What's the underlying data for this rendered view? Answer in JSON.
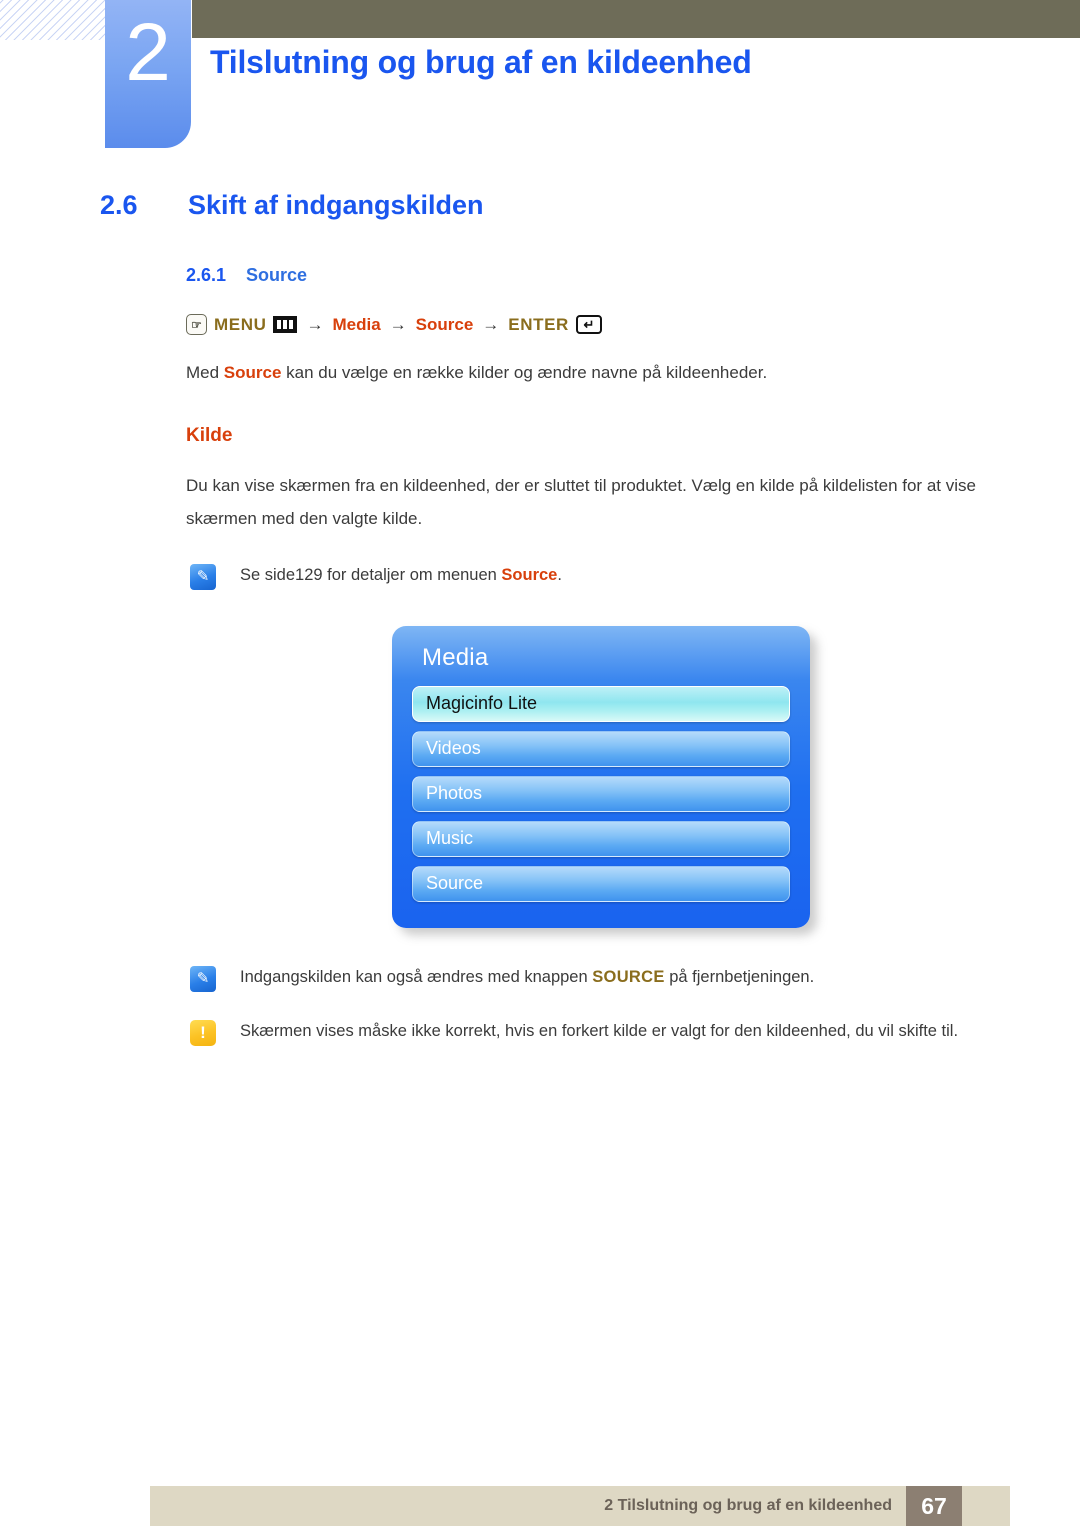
{
  "header": {
    "chapter_number": "2",
    "chapter_title": "Tilslutning og brug af en kildeenhed",
    "bar_color": "#6e6c58",
    "tab_color": "#7aa5f2",
    "title_color": "#1a56ef"
  },
  "section": {
    "number": "2.6",
    "title": "Skift af indgangskilden",
    "sub_number": "2.6.1",
    "sub_title": "Source"
  },
  "nav_path": {
    "hand_icon": "hand-pointer-icon",
    "menu_label": "MENU",
    "bars_icon": "menu-bars-icon",
    "arrow1": "→",
    "media_label": "Media",
    "arrow2": "→",
    "source_label": "Source",
    "arrow3": "→",
    "enter_label": "ENTER",
    "enter_icon": "enter-key-icon",
    "gold_color": "#8a6d1d",
    "red_color": "#d8400c"
  },
  "intro": {
    "prefix": "Med ",
    "highlight": "Source",
    "suffix": " kan du vælge en række kilder og ændre navne på kildeenheder."
  },
  "subheading": "Kilde",
  "description": "Du kan vise skærmen fra en kildeenhed, der er sluttet til produktet. Vælg en kilde på kildelisten for at vise skærmen med den valgte kilde.",
  "notes": [
    {
      "icon": "note-pen-icon",
      "prefix": "Se side129 for detaljer om menuen ",
      "highlight": "Source",
      "highlight_style": "red",
      "suffix": "."
    },
    {
      "icon": "note-pen-icon",
      "prefix": "Indgangskilden kan også ændres med knappen ",
      "highlight": "SOURCE",
      "highlight_style": "gold",
      "suffix": " på fjernbetjeningen."
    },
    {
      "icon": "warning-icon",
      "prefix": "Skærmen vises måske ikke korrekt, hvis en forkert kilde er valgt for den kildeenhed, du vil skifte til.",
      "highlight": "",
      "highlight_style": "none",
      "suffix": ""
    }
  ],
  "osd": {
    "title": "Media",
    "items": [
      {
        "label": "Magicinfo Lite",
        "selected": true
      },
      {
        "label": "Videos",
        "selected": false
      },
      {
        "label": "Photos",
        "selected": false
      },
      {
        "label": "Music",
        "selected": false
      },
      {
        "label": "Source",
        "selected": false
      }
    ],
    "panel_color": "#1f6ff0",
    "selected_color": "#8fe6ef"
  },
  "footer": {
    "text": "2 Tilslutning og brug af en kildeenhed",
    "page_number": "67",
    "bar_color": "#ded8c4",
    "page_box_color": "#8c7f72"
  }
}
